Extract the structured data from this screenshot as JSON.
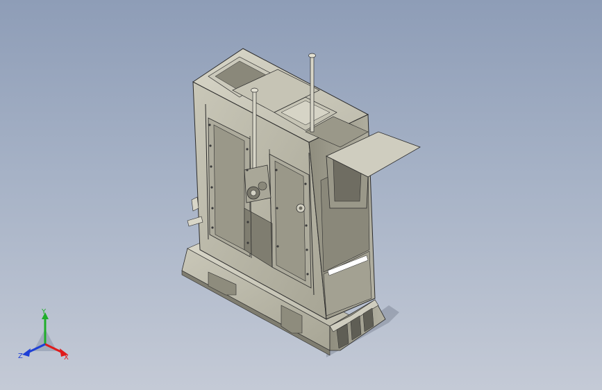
{
  "viewport": {
    "background_top": "#8e9db7",
    "background_bottom": "#c4cad6"
  },
  "model": {
    "body_color": "#b6b4a3",
    "body_dark": "#8d8b7c",
    "body_light": "#d2d0c2",
    "edge_color": "#2a2a2a"
  },
  "triad": {
    "x_label": "X",
    "y_label": "Y",
    "z_label": "Z",
    "x_color": "#e01b1b",
    "y_color": "#1fae2a",
    "z_color": "#1e3fd6"
  }
}
